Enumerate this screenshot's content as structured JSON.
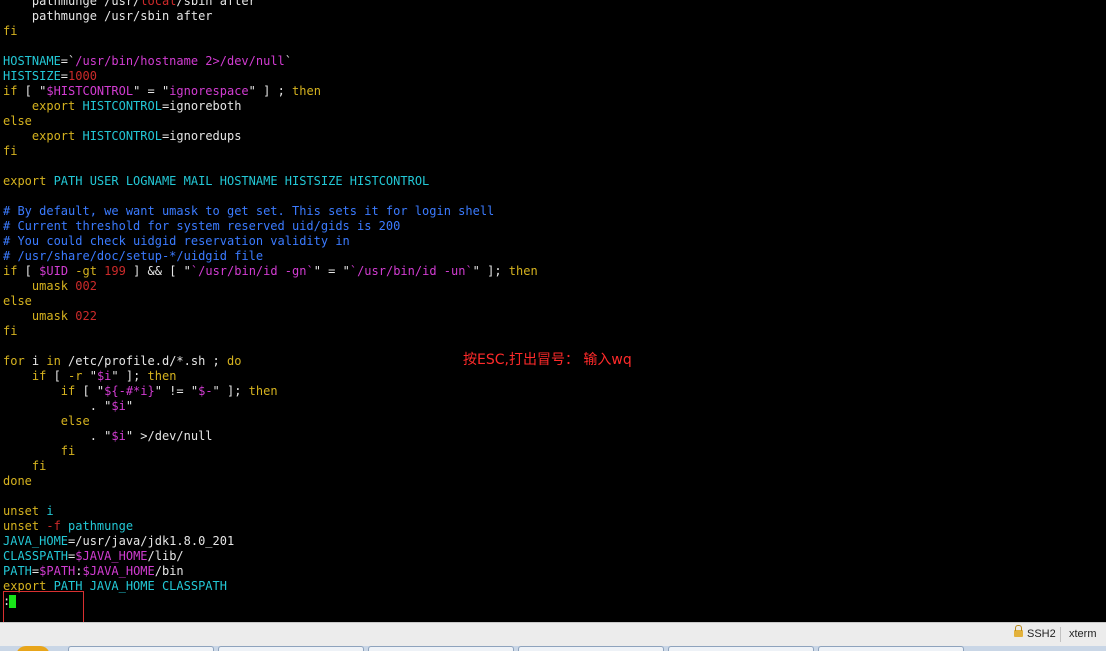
{
  "terminal": {
    "lines": [
      [
        {
          "t": "    pathmunge /usr/",
          "c": "#e6e6e6"
        },
        {
          "t": "local",
          "c": "#cc2a2a"
        },
        {
          "t": "/sbin after",
          "c": "#e6e6e6"
        }
      ],
      [
        {
          "t": "    pathmunge /usr/sbin after",
          "c": "#e6e6e6"
        }
      ],
      [
        {
          "t": "fi",
          "c": "#d6b31f"
        }
      ],
      [],
      [
        {
          "t": "HOSTNAME",
          "c": "#23c8d6"
        },
        {
          "t": "=`",
          "c": "#e6e6e6"
        },
        {
          "t": "/usr/bin/hostname 2>/dev/null",
          "c": "#d23cd2"
        },
        {
          "t": "`",
          "c": "#e6e6e6"
        }
      ],
      [
        {
          "t": "HISTSIZE",
          "c": "#23c8d6"
        },
        {
          "t": "=",
          "c": "#e6e6e6"
        },
        {
          "t": "1000",
          "c": "#cc2a2a"
        }
      ],
      [
        {
          "t": "if",
          "c": "#d6b31f"
        },
        {
          "t": " [ \"",
          "c": "#e6e6e6"
        },
        {
          "t": "$HISTCONTROL",
          "c": "#d23cd2"
        },
        {
          "t": "\" = \"",
          "c": "#e6e6e6"
        },
        {
          "t": "ignorespace",
          "c": "#d23cd2"
        },
        {
          "t": "\" ] ; ",
          "c": "#e6e6e6"
        },
        {
          "t": "then",
          "c": "#d6b31f"
        }
      ],
      [
        {
          "t": "    export ",
          "c": "#d6b31f"
        },
        {
          "t": "HISTCONTROL",
          "c": "#23c8d6"
        },
        {
          "t": "=ignoreboth",
          "c": "#e6e6e6"
        }
      ],
      [
        {
          "t": "else",
          "c": "#d6b31f"
        }
      ],
      [
        {
          "t": "    export ",
          "c": "#d6b31f"
        },
        {
          "t": "HISTCONTROL",
          "c": "#23c8d6"
        },
        {
          "t": "=ignoredups",
          "c": "#e6e6e6"
        }
      ],
      [
        {
          "t": "fi",
          "c": "#d6b31f"
        }
      ],
      [],
      [
        {
          "t": "export",
          "c": "#d6b31f"
        },
        {
          "t": " PATH USER LOGNAME MAIL HOSTNAME HISTSIZE HISTCONTROL",
          "c": "#23c8d6"
        }
      ],
      [],
      [
        {
          "t": "# By default, we want umask to get set. This sets it for login shell",
          "c": "#3b7bff"
        }
      ],
      [
        {
          "t": "# Current threshold for system reserved uid/gids is 200",
          "c": "#3b7bff"
        }
      ],
      [
        {
          "t": "# You could check uidgid reservation validity in",
          "c": "#3b7bff"
        }
      ],
      [
        {
          "t": "# /usr/share/doc/setup-*/uidgid file",
          "c": "#3b7bff"
        }
      ],
      [
        {
          "t": "if",
          "c": "#d6b31f"
        },
        {
          "t": " [ ",
          "c": "#e6e6e6"
        },
        {
          "t": "$UID",
          "c": "#d23cd2"
        },
        {
          "t": " -gt ",
          "c": "#d6b31f"
        },
        {
          "t": "199",
          "c": "#cc2a2a"
        },
        {
          "t": " ] && [ \"",
          "c": "#e6e6e6"
        },
        {
          "t": "`/usr/bin/id -gn`",
          "c": "#d23cd2"
        },
        {
          "t": "\" = \"",
          "c": "#e6e6e6"
        },
        {
          "t": "`/usr/bin/id -un`",
          "c": "#d23cd2"
        },
        {
          "t": "\" ]; ",
          "c": "#e6e6e6"
        },
        {
          "t": "then",
          "c": "#d6b31f"
        }
      ],
      [
        {
          "t": "    umask ",
          "c": "#d6b31f"
        },
        {
          "t": "002",
          "c": "#cc2a2a"
        }
      ],
      [
        {
          "t": "else",
          "c": "#d6b31f"
        }
      ],
      [
        {
          "t": "    umask ",
          "c": "#d6b31f"
        },
        {
          "t": "022",
          "c": "#cc2a2a"
        }
      ],
      [
        {
          "t": "fi",
          "c": "#d6b31f"
        }
      ],
      [],
      [
        {
          "t": "for",
          "c": "#d6b31f"
        },
        {
          "t": " i ",
          "c": "#e6e6e6"
        },
        {
          "t": "in",
          "c": "#d6b31f"
        },
        {
          "t": " /etc/profile.d/*.sh ; ",
          "c": "#e6e6e6"
        },
        {
          "t": "do",
          "c": "#d6b31f"
        }
      ],
      [
        {
          "t": "    if",
          "c": "#d6b31f"
        },
        {
          "t": " [ ",
          "c": "#e6e6e6"
        },
        {
          "t": "-r",
          "c": "#d6b31f"
        },
        {
          "t": " \"",
          "c": "#e6e6e6"
        },
        {
          "t": "$i",
          "c": "#d23cd2"
        },
        {
          "t": "\" ]; ",
          "c": "#e6e6e6"
        },
        {
          "t": "then",
          "c": "#d6b31f"
        }
      ],
      [
        {
          "t": "        if",
          "c": "#d6b31f"
        },
        {
          "t": " [ \"",
          "c": "#e6e6e6"
        },
        {
          "t": "${-#*i}",
          "c": "#d23cd2"
        },
        {
          "t": "\" != \"",
          "c": "#e6e6e6"
        },
        {
          "t": "$-",
          "c": "#d23cd2"
        },
        {
          "t": "\" ]; ",
          "c": "#e6e6e6"
        },
        {
          "t": "then",
          "c": "#d6b31f"
        }
      ],
      [
        {
          "t": "            . \"",
          "c": "#e6e6e6"
        },
        {
          "t": "$i",
          "c": "#d23cd2"
        },
        {
          "t": "\"",
          "c": "#e6e6e6"
        }
      ],
      [
        {
          "t": "        else",
          "c": "#d6b31f"
        }
      ],
      [
        {
          "t": "            . \"",
          "c": "#e6e6e6"
        },
        {
          "t": "$i",
          "c": "#d23cd2"
        },
        {
          "t": "\" >/dev/null",
          "c": "#e6e6e6"
        }
      ],
      [
        {
          "t": "        fi",
          "c": "#d6b31f"
        }
      ],
      [
        {
          "t": "    fi",
          "c": "#d6b31f"
        }
      ],
      [
        {
          "t": "done",
          "c": "#d6b31f"
        }
      ],
      [],
      [
        {
          "t": "unset",
          "c": "#d6b31f"
        },
        {
          "t": " i",
          "c": "#23c8d6"
        }
      ],
      [
        {
          "t": "unset",
          "c": "#d6b31f"
        },
        {
          "t": " -f ",
          "c": "#cc2a2a"
        },
        {
          "t": "pathmunge",
          "c": "#23c8d6"
        }
      ],
      [
        {
          "t": "JAVA_HOME",
          "c": "#23c8d6"
        },
        {
          "t": "=/usr/java/jdk1.8.0_201",
          "c": "#e6e6e6"
        }
      ],
      [
        {
          "t": "CLASSPATH",
          "c": "#23c8d6"
        },
        {
          "t": "=",
          "c": "#e6e6e6"
        },
        {
          "t": "$JAVA_HOME",
          "c": "#d23cd2"
        },
        {
          "t": "/lib/",
          "c": "#e6e6e6"
        }
      ],
      [
        {
          "t": "PATH",
          "c": "#23c8d6"
        },
        {
          "t": "=",
          "c": "#e6e6e6"
        },
        {
          "t": "$PATH",
          "c": "#d23cd2"
        },
        {
          "t": ":",
          "c": "#e6e6e6"
        },
        {
          "t": "$JAVA_HOME",
          "c": "#d23cd2"
        },
        {
          "t": "/bin",
          "c": "#e6e6e6"
        }
      ],
      [
        {
          "t": "export",
          "c": "#d6b31f"
        },
        {
          "t": " PATH JAVA_HOME CLASSPATH",
          "c": "#23c8d6"
        }
      ],
      [
        {
          "t": ":",
          "c": "#e6e6e6"
        }
      ]
    ],
    "annotation": "按ESC,打出冒号： 输入wq",
    "cursor_color": "#19e519"
  },
  "statusbar": {
    "protocol": "SSH2",
    "term_type": "xterm",
    "lock_icon": "lock-icon"
  },
  "colors": {
    "background": "#000000",
    "keyword": "#d6b31f",
    "variable": "#23c8d6",
    "string": "#d23cd2",
    "number": "#cc2a2a",
    "comment": "#3b7bff",
    "annotation": "#ff2a2a"
  }
}
